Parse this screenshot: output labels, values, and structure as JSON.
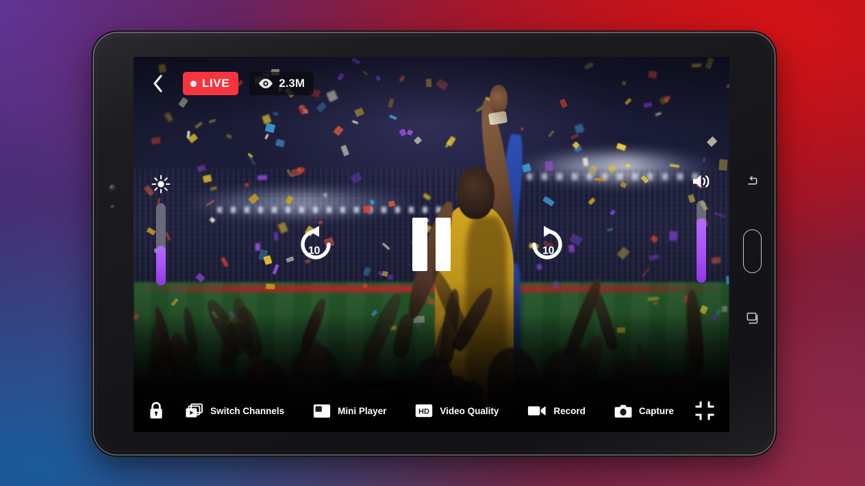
{
  "wallpaper": {
    "colors": {
      "top_left": "#62349 6",
      "top_left_hex": "#623496",
      "top_right": "#d61216",
      "bottom_left": "#145e9e",
      "bottom_right": "#942a4a"
    }
  },
  "device": {
    "type": "android-tablet",
    "nav_keys": [
      {
        "name": "back",
        "icon": "back-arrow-icon"
      },
      {
        "name": "home",
        "icon": "home-pill-icon"
      },
      {
        "name": "recents",
        "icon": "recents-squares-icon"
      }
    ],
    "bezel_sensors": [
      "front-camera",
      "light-sensor"
    ]
  },
  "player": {
    "top_bar": {
      "back_icon": "chevron-left-icon",
      "live_label": "LIVE",
      "live_color": "#f8353f",
      "viewer_icon": "eye-icon",
      "viewer_count": "2.3M"
    },
    "brightness": {
      "icon": "brightness-sun-icon",
      "label": "Brightness",
      "value": 48,
      "fill_color": "#a855f7"
    },
    "volume": {
      "icon": "volume-speaker-icon",
      "label": "Volume",
      "value": 78,
      "fill_color": "#a855f7"
    },
    "center_controls": {
      "rewind": {
        "icon": "replay-10-icon",
        "label": "10"
      },
      "play_pause": {
        "icon": "pause-icon",
        "state": "playing"
      },
      "forward": {
        "icon": "forward-10-icon",
        "label": "10"
      }
    },
    "bottom_bar": {
      "lock": {
        "icon": "lock-icon",
        "label": "Lock"
      },
      "actions": [
        {
          "icon": "switch-channels-icon",
          "label": "Switch Channels"
        },
        {
          "icon": "mini-player-icon",
          "label": "Mini Player"
        },
        {
          "icon": "hd-icon",
          "label": "Video Quality"
        },
        {
          "icon": "video-camera-icon",
          "label": "Record"
        },
        {
          "icon": "camera-icon",
          "label": "Capture"
        }
      ],
      "fullscreen": {
        "icon": "exit-fullscreen-icon",
        "label": "Exit Fullscreen"
      }
    }
  },
  "video": {
    "scene": "Stadium celebration with confetti, crowd and fan waving flag"
  }
}
